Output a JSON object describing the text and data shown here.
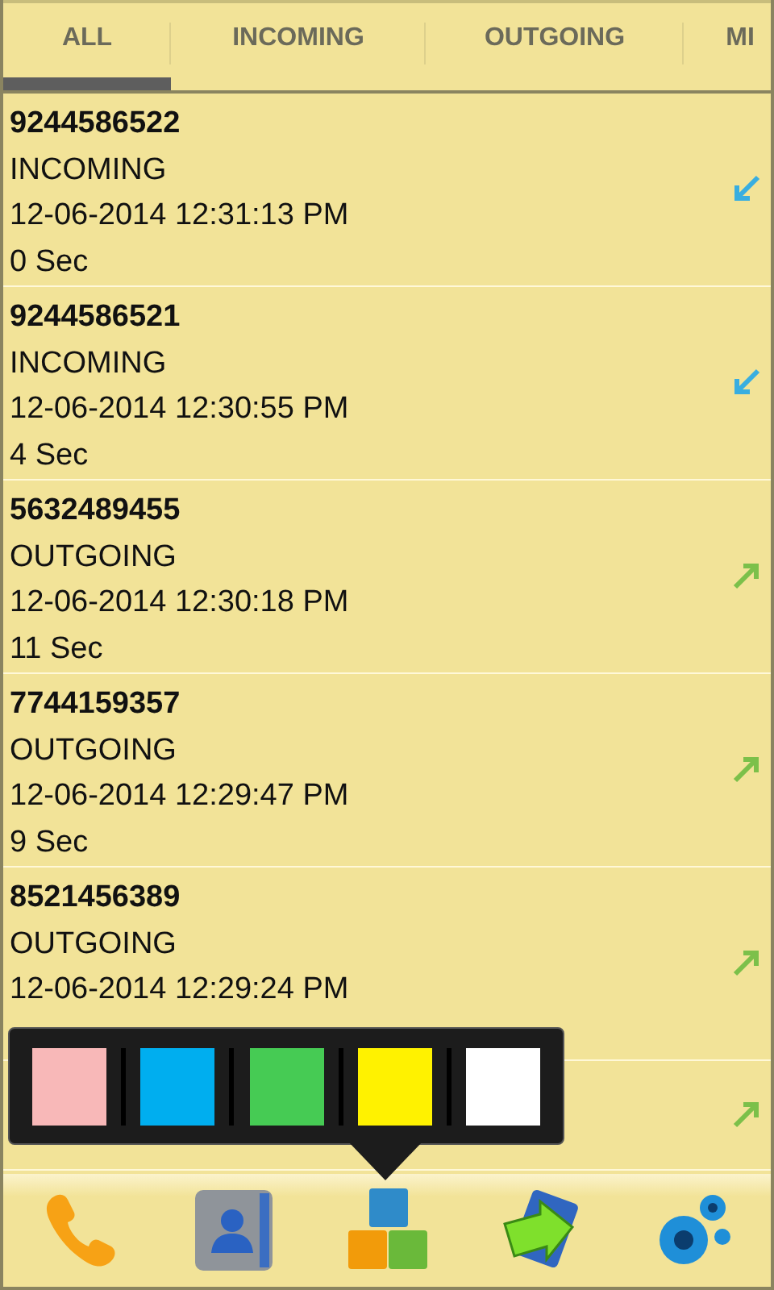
{
  "tabs": [
    {
      "label": "ALL",
      "selected": true
    },
    {
      "label": "INCOMING",
      "selected": false
    },
    {
      "label": "OUTGOING",
      "selected": false
    },
    {
      "label": "MI",
      "selected": false
    }
  ],
  "calls": [
    {
      "number": "9244586522",
      "type": "INCOMING",
      "time": "12-06-2014 12:31:13 PM",
      "duration": "0 Sec",
      "kind": "incoming"
    },
    {
      "number": "9244586521",
      "type": "INCOMING",
      "time": "12-06-2014 12:30:55 PM",
      "duration": "4 Sec",
      "kind": "incoming"
    },
    {
      "number": "5632489455",
      "type": "OUTGOING",
      "time": "12-06-2014 12:30:18 PM",
      "duration": "11 Sec",
      "kind": "outgoing"
    },
    {
      "number": "7744159357",
      "type": "OUTGOING",
      "time": "12-06-2014 12:29:47 PM",
      "duration": "9 Sec",
      "kind": "outgoing"
    },
    {
      "number": "8521456389",
      "type": "OUTGOING",
      "time": "12-06-2014 12:29:24 PM",
      "kind": "outgoing"
    },
    {
      "kind": "outgoing"
    }
  ],
  "color_picker": {
    "swatches": [
      {
        "color": "#f8b8b8"
      },
      {
        "color": "#00aeef"
      },
      {
        "color": "#46cb54"
      },
      {
        "color": "#fff200"
      },
      {
        "color": "#ffffff"
      }
    ]
  },
  "bottom_bar": [
    {
      "kind": "phone"
    },
    {
      "kind": "contacts"
    },
    {
      "kind": "blocks"
    },
    {
      "kind": "transfer"
    },
    {
      "kind": "settings"
    }
  ]
}
